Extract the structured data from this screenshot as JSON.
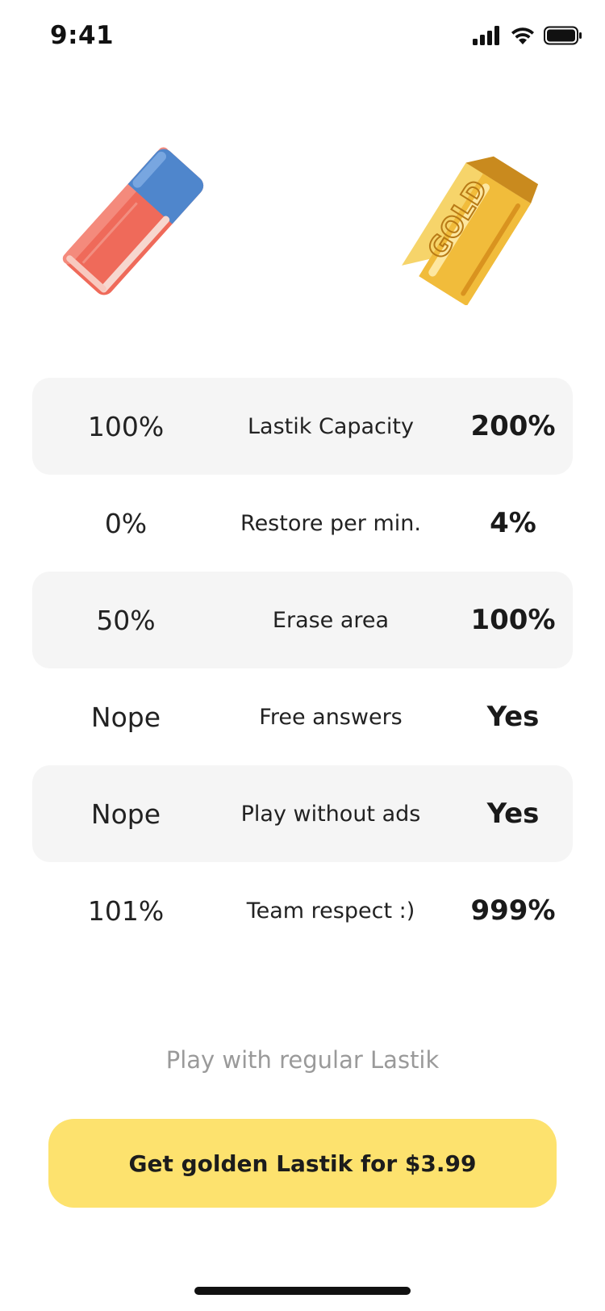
{
  "status_bar": {
    "time": "9:41",
    "icons": [
      "cellular-signal-icon",
      "wifi-icon",
      "battery-icon"
    ]
  },
  "hero": {
    "left_image": "eraser-illustration",
    "right_image": "gold-bar-illustration",
    "gold_bar_text": "GOLD"
  },
  "comparison": {
    "rows": [
      {
        "regular": "100%",
        "feature": "Lastik Capacity",
        "golden": "200%"
      },
      {
        "regular": "0%",
        "feature": "Restore per min.",
        "golden": "4%"
      },
      {
        "regular": "50%",
        "feature": "Erase area",
        "golden": "100%"
      },
      {
        "regular": "Nope",
        "feature": "Free answers",
        "golden": "Yes"
      },
      {
        "regular": "Nope",
        "feature": "Play without ads",
        "golden": "Yes"
      },
      {
        "regular": "101%",
        "feature": "Team respect :)",
        "golden": "999%"
      }
    ]
  },
  "actions": {
    "regular_link": "Play with regular Lastik",
    "purchase_button": "Get golden Lastik for $3.99"
  },
  "colors": {
    "cta_background": "#fde26e",
    "row_shade": "#f5f5f5",
    "link_text": "#9a9a9a",
    "eraser_red": "#ef6a5a",
    "eraser_blue": "#4f86cc",
    "gold": "#f1bc3b"
  }
}
